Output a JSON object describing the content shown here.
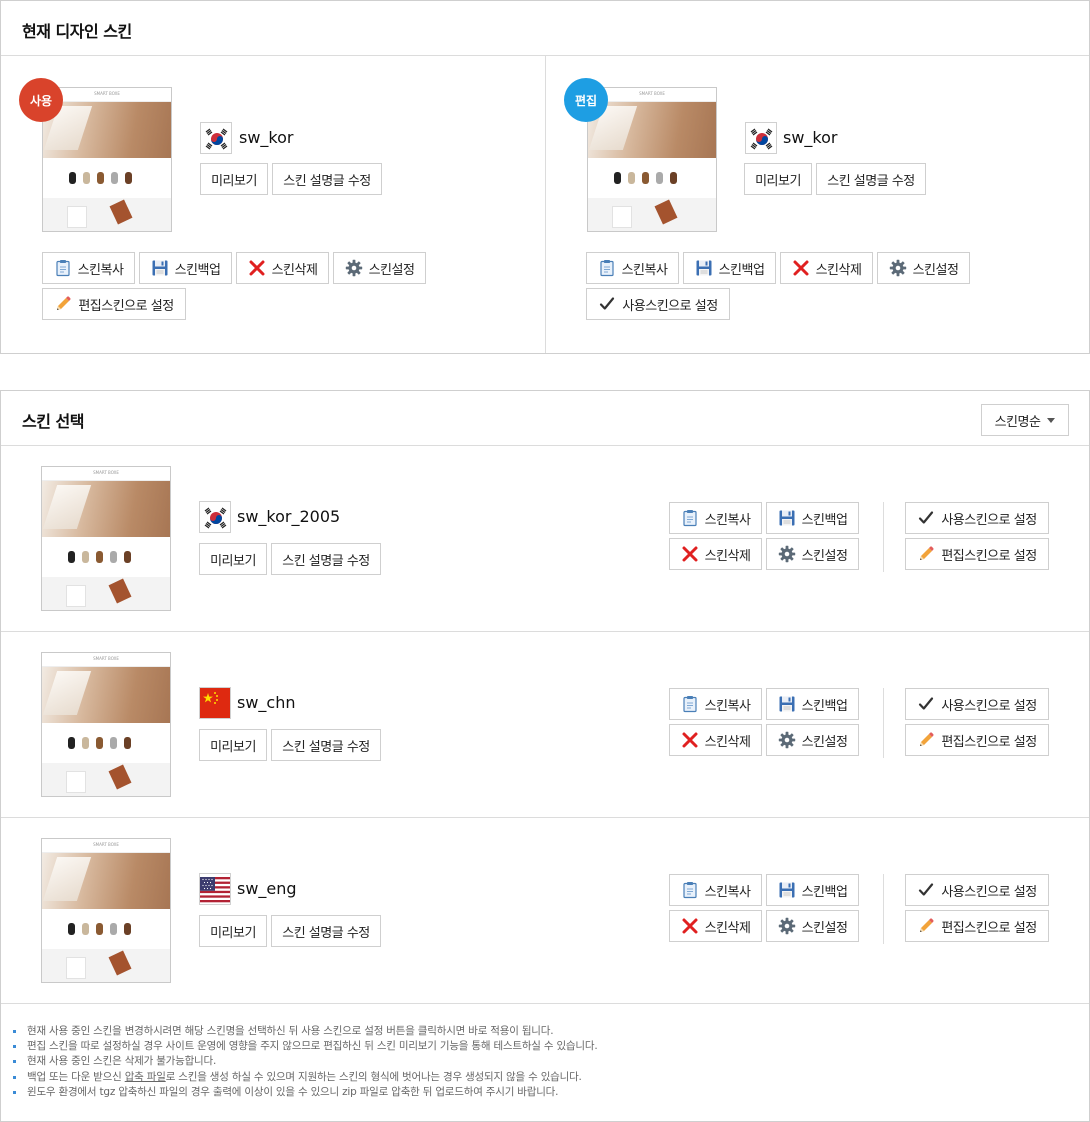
{
  "current_panel": {
    "title": "현재 디자인 스킨",
    "use_skin": {
      "badge": "사용",
      "name": "sw_kor",
      "flag": "korea-flag-icon",
      "preview_label": "미리보기",
      "edit_desc_label": "스킨 설명글 수정",
      "copy_label": "스킨복사",
      "backup_label": "스킨백업",
      "delete_label": "스킨삭제",
      "settings_label": "스킨설정",
      "set_edit_label": "편집스킨으로 설정"
    },
    "edit_skin": {
      "badge": "편집",
      "name": "sw_kor",
      "flag": "korea-flag-icon",
      "preview_label": "미리보기",
      "edit_desc_label": "스킨 설명글 수정",
      "copy_label": "스킨복사",
      "backup_label": "스킨백업",
      "delete_label": "스킨삭제",
      "settings_label": "스킨설정",
      "set_use_label": "사용스킨으로 설정"
    }
  },
  "select_panel": {
    "title": "스킨 선택",
    "sort_label": "스킨명순",
    "skins": [
      {
        "name": "sw_kor_2005",
        "flag": "korea-flag-icon"
      },
      {
        "name": "sw_chn",
        "flag": "china-flag-icon"
      },
      {
        "name": "sw_eng",
        "flag": "usa-flag-icon"
      }
    ],
    "labels": {
      "preview": "미리보기",
      "edit_desc": "스킨 설명글 수정",
      "copy": "스킨복사",
      "backup": "스킨백업",
      "delete": "스킨삭제",
      "settings": "스킨설정",
      "set_use": "사용스킨으로 설정",
      "set_edit": "편집스킨으로 설정"
    },
    "notes": [
      "현재 사용 중인 스킨을 변경하시려면 해당 스킨명을 선택하신 뒤 사용 스킨으로 설정 버튼을 클릭하시면 바로 적용이 됩니다.",
      "편집 스킨을 따로 설정하실 경우 사이트 운영에 영향을 주지 않으므로 편집하신 뒤 스킨 미리보기 기능을 통해 테스트하실 수 있습니다.",
      "현재 사용 중인 스킨은 삭제가 불가능합니다.",
      "백업 또는 다운 받으신 압축 파일로 스킨을 생성 하실 수 있으며 지원하는 스킨의 형식에 벗어나는 경우 생성되지 않을 수 있습니다.",
      "윈도우 환경에서 tgz 압축하신 파일의 경우 출력에 이상이 있을 수 있으니 zip 파일로 압축한 뒤 업로드하여 주시기 바랍니다."
    ],
    "note_underline": "압축 파일"
  },
  "colors": {
    "use_badge": "#d9432b",
    "edit_badge": "#1e9ee3",
    "delete_icon": "#e02020",
    "note_bullet": "#3a8bd6"
  }
}
